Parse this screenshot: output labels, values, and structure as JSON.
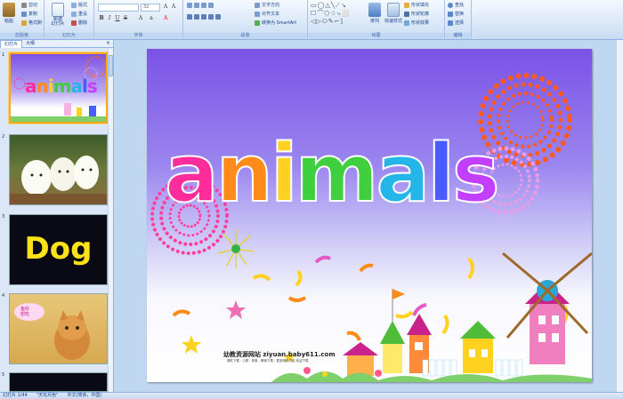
{
  "ribbon": {
    "clipboard": {
      "group": "剪贴板",
      "paste": "粘贴",
      "cut": "剪切",
      "copy": "复制",
      "format_painter": "格式刷"
    },
    "slides": {
      "group": "幻灯片",
      "new_slide": "新建\n幻灯片",
      "layout": "版式",
      "reset": "重设",
      "delete": "删除"
    },
    "font": {
      "group": "字体",
      "font_name": "",
      "font_size": "32"
    },
    "paragraph": {
      "group": "段落",
      "text_direction": "文字方向",
      "align_text": "对齐文本",
      "smartart": "转换为 SmartArt"
    },
    "drawing": {
      "group": "绘图",
      "arrange": "排列",
      "quick_styles": "快速样式",
      "fill": "形状填充",
      "outline": "形状轮廓",
      "effects": "形状效果"
    },
    "editing": {
      "group": "编辑",
      "find": "查找",
      "replace": "替换",
      "select": "选择"
    }
  },
  "pane": {
    "tabs": [
      "幻灯片",
      "大纲"
    ],
    "close": "×",
    "thumbs": [
      {
        "num": "1",
        "title": "animals"
      },
      {
        "num": "2"
      },
      {
        "num": "3",
        "title": "Dog"
      },
      {
        "num": "4",
        "bubble": "鱼好\n想吃"
      },
      {
        "num": "5"
      }
    ]
  },
  "slide": {
    "title_letters": [
      "a",
      "n",
      "i",
      "m",
      "a",
      "l",
      "s"
    ],
    "letter_colors": [
      "#ff2d9b",
      "#ff8c1a",
      "#ffd21f",
      "#3fcf3f",
      "#24b6e8",
      "#4a5cff",
      "#c23fff"
    ],
    "site_text": "幼教资源网站  ziyuan.baby611.com",
    "site_sub": "课件下载 · 儿歌 · 故事 · 教案下载 · 更多精彩内容 欢迎下载"
  },
  "status": {
    "slide_num": "幻灯片 1/44",
    "theme": "\"天坛月色\"",
    "lang": "中文(简体，中国)"
  }
}
